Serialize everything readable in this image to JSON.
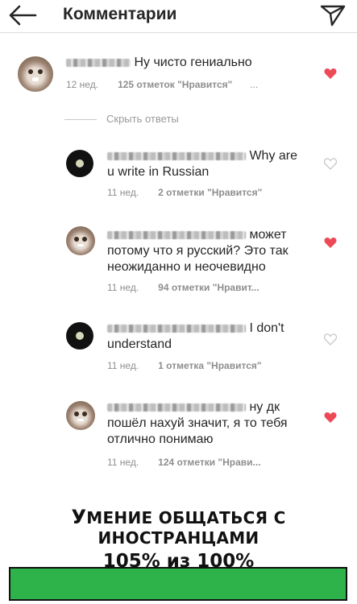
{
  "header": {
    "title": "Комментарии",
    "back_icon": "arrow-left-icon",
    "send_icon": "paper-plane-icon"
  },
  "comments": [
    {
      "text": "Ну чисто гениально",
      "time": "12 нед.",
      "likes": "125 отметок \"Нравится\"",
      "more": "...",
      "liked": true,
      "avatar": "cat"
    },
    {
      "text": "Why are u write in Russian",
      "time": "11 нед.",
      "likes": "2 отметки \"Нравится\"",
      "liked": false,
      "avatar": "disc"
    },
    {
      "text": "может потому что я русский? Это так неожиданно и неочевидно",
      "time": "11 нед.",
      "likes": "94 отметки \"Нравит...",
      "liked": true,
      "avatar": "cat"
    },
    {
      "text": "I don't understand",
      "time": "11 нед.",
      "likes": "1 отметка \"Нравится\"",
      "liked": false,
      "avatar": "disc"
    },
    {
      "text": "ну дк пошёл нахуй значит, я то тебя отлично понимаю",
      "time": "11 нед.",
      "likes": "124 отметки \"Нрави...",
      "liked": true,
      "avatar": "cat"
    }
  ],
  "hide_replies_label": "Скрыть ответы",
  "caption": {
    "line1_first": "У",
    "line1_rest": "мение общаться с иностранцами",
    "line2": "105% из 100%"
  },
  "progress": {
    "value": 1.0,
    "color": "#2db34a"
  },
  "colors": {
    "liked_heart": "#ed4956",
    "unliked_heart": "#c7c7c7"
  }
}
